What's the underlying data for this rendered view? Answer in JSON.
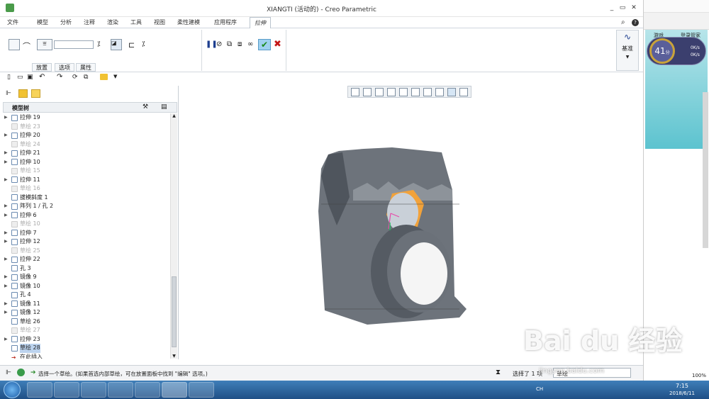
{
  "window": {
    "title": "XIANGTI (活动的) - Creo Parametric"
  },
  "menu": {
    "items": [
      "文件",
      "模型",
      "分析",
      "注释",
      "渲染",
      "工具",
      "视图",
      "柔性建模",
      "应用程序"
    ],
    "active_tab": "拉伸"
  },
  "ribbon": {
    "subtabs": [
      "放置",
      "选项",
      "属性"
    ],
    "datum_label": "基准"
  },
  "panel": {
    "title": "模型树"
  },
  "tree": [
    {
      "label": "拉伸 19",
      "dim": false,
      "arrow": true
    },
    {
      "label": "草绘 23",
      "dim": true,
      "arrow": false
    },
    {
      "label": "拉伸 20",
      "dim": false,
      "arrow": true
    },
    {
      "label": "草绘 24",
      "dim": true,
      "arrow": false
    },
    {
      "label": "拉伸 21",
      "dim": false,
      "arrow": true
    },
    {
      "label": "拉伸 10",
      "dim": false,
      "arrow": true
    },
    {
      "label": "草绘 15",
      "dim": true,
      "arrow": false
    },
    {
      "label": "拉伸 11",
      "dim": false,
      "arrow": true
    },
    {
      "label": "草绘 16",
      "dim": true,
      "arrow": false
    },
    {
      "label": "拔模斜度 1",
      "dim": false,
      "arrow": false
    },
    {
      "label": "阵列 1 / 孔 2",
      "dim": false,
      "arrow": true
    },
    {
      "label": "拉伸 6",
      "dim": false,
      "arrow": true
    },
    {
      "label": "草绘 10",
      "dim": true,
      "arrow": false
    },
    {
      "label": "拉伸 7",
      "dim": false,
      "arrow": true
    },
    {
      "label": "拉伸 12",
      "dim": false,
      "arrow": true
    },
    {
      "label": "草绘 25",
      "dim": true,
      "arrow": false
    },
    {
      "label": "拉伸 22",
      "dim": false,
      "arrow": true
    },
    {
      "label": "孔 3",
      "dim": false,
      "arrow": false
    },
    {
      "label": "镜像 9",
      "dim": false,
      "arrow": true
    },
    {
      "label": "镜像 10",
      "dim": false,
      "arrow": true
    },
    {
      "label": "孔 4",
      "dim": false,
      "arrow": false
    },
    {
      "label": "镜像 11",
      "dim": false,
      "arrow": true
    },
    {
      "label": "镜像 12",
      "dim": false,
      "arrow": true
    },
    {
      "label": "草绘 26",
      "dim": false,
      "arrow": false
    },
    {
      "label": "草绘 27",
      "dim": true,
      "arrow": false
    },
    {
      "label": "拉伸 23",
      "dim": false,
      "arrow": true
    },
    {
      "label": "草绘 28",
      "dim": false,
      "arrow": false,
      "selected": true
    },
    {
      "label": "在此插入",
      "dim": false,
      "arrow": false,
      "insert": true
    }
  ],
  "status": {
    "message": "选择一个草绘。(如果首选内部草绘，可在放置面板中找到 \"编辑\" 选项。)",
    "selected": "选择了 1 项",
    "filter": "草绘"
  },
  "sidebar": {
    "score": "41",
    "score_unit": "分",
    "login": "登录管家",
    "speed_up": "0K/s",
    "speed_down": "0K/s",
    "zoom": "100%",
    "short_label": "游戏"
  },
  "clock": {
    "time": "7:15",
    "date": "2018/6/11"
  },
  "tray": {
    "lang": "CH"
  },
  "watermark": {
    "text": "Bai du 经验",
    "url": "jingyan.baidu.com"
  }
}
